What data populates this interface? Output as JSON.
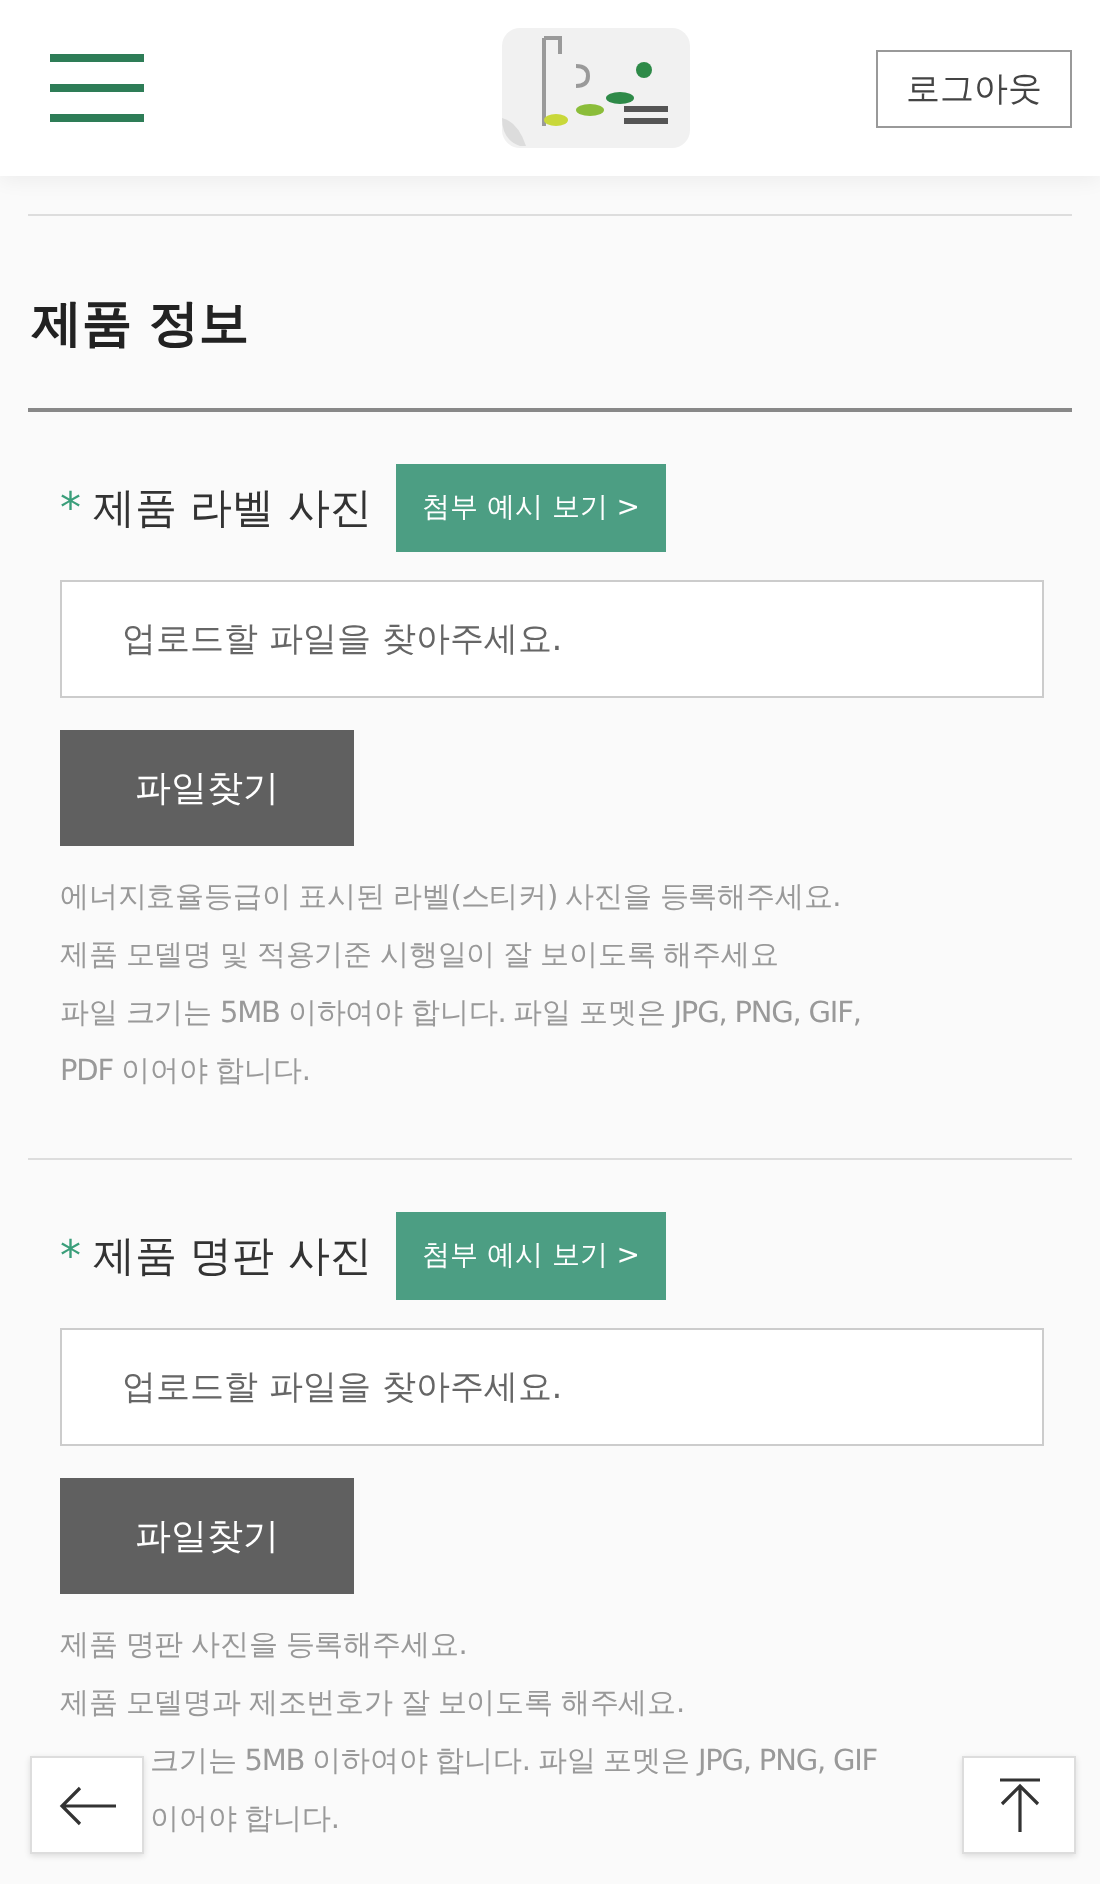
{
  "header": {
    "logout": "로그아웃"
  },
  "title": "제품 정보",
  "sections": [
    {
      "marker": "*",
      "label": "제품 라벨 사진",
      "example_button": "첨부 예시 보기 >",
      "placeholder": "업로드할 파일을 찾아주세요.",
      "file_button": "파일찾기",
      "notes": [
        {
          "kind": "line",
          "text": "에너지효율등급이 표시된 라벨(스티커) 사진을 등록해주세요."
        },
        {
          "kind": "line",
          "text": "제품 모델명 및 적용기준 시행일이 잘 보이도록 해주세요"
        },
        {
          "kind": "line",
          "text": "파일 크기는 5MB 이하여야 합니다. 파일 포멧은 JPG, PNG, GIF,"
        },
        {
          "kind": "line",
          "text": "PDF 이어야 합니다."
        }
      ]
    },
    {
      "marker": "*",
      "label": "제품 명판 사진",
      "example_button": "첨부 예시 보기 >",
      "placeholder": "업로드할 파일을 찾아주세요.",
      "file_button": "파일찾기",
      "notes": [
        {
          "kind": "line",
          "text": "제품 명판 사진을 등록해주세요."
        },
        {
          "kind": "line",
          "text": "제품 모델명과 제조번호가 잘 보이도록 해주세요."
        },
        {
          "kind": "covered",
          "text": "크기는 5MB 이하여야 합니다. 파일 포멧은 JPG, PNG, GIF"
        },
        {
          "kind": "covered",
          "text": "이어야 합니다."
        }
      ]
    }
  ]
}
